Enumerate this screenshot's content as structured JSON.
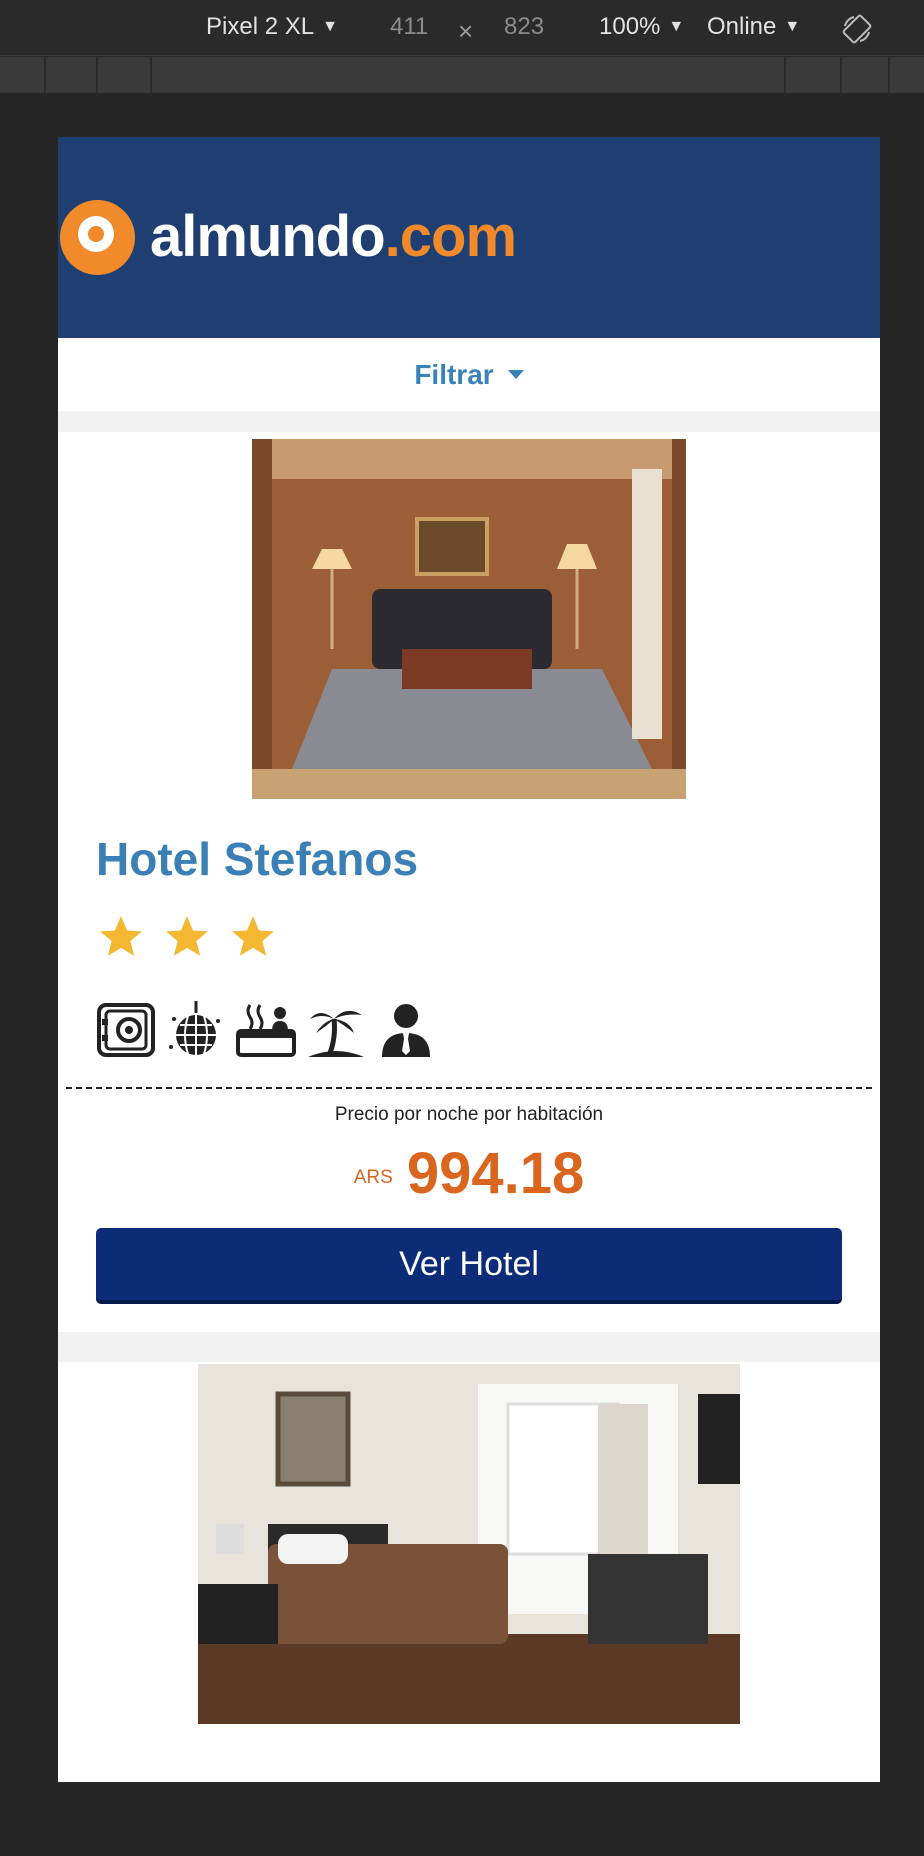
{
  "devtools": {
    "device": "Pixel 2 XL",
    "width": "411",
    "times": "×",
    "height": "823",
    "zoom": "100%",
    "network": "Online"
  },
  "header": {
    "logo_text_main": "almundo",
    "logo_text_domain": ".com",
    "background_color": "#1f3f73",
    "accent_color": "#f08a2a"
  },
  "filter": {
    "label": "Filtrar"
  },
  "hotels": [
    {
      "name": "Hotel Stefanos",
      "star_rating": 3,
      "amenity_icons": [
        "safe-box-icon",
        "disco-ball-icon",
        "hot-tub-icon",
        "beach-palm-icon",
        "business-person-icon"
      ],
      "price_label": "Precio por noche por habitación",
      "currency": "ARS",
      "price": "994.18",
      "button_label": "Ver Hotel"
    }
  ]
}
